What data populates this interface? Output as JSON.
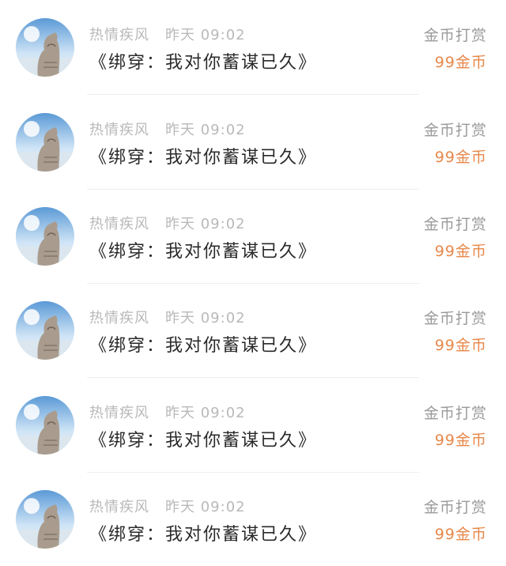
{
  "colors": {
    "meta_text": "#b9b9b9",
    "title_text": "#2a2a2a",
    "action_text": "#9a9a9a",
    "amount_text": "#e7884a"
  },
  "entries": [
    {
      "user": "热情疾风",
      "time": "昨天 09:02",
      "title": "《绑穿：我对你蓄谋已久》",
      "action": "金币打赏",
      "amount": "99金币",
      "avatar": "kitten-avatar"
    },
    {
      "user": "热情疾风",
      "time": "昨天 09:02",
      "title": "《绑穿：我对你蓄谋已久》",
      "action": "金币打赏",
      "amount": "99金币",
      "avatar": "kitten-avatar"
    },
    {
      "user": "热情疾风",
      "time": "昨天 09:02",
      "title": "《绑穿：我对你蓄谋已久》",
      "action": "金币打赏",
      "amount": "99金币",
      "avatar": "kitten-avatar"
    },
    {
      "user": "热情疾风",
      "time": "昨天 09:02",
      "title": "《绑穿：我对你蓄谋已久》",
      "action": "金币打赏",
      "amount": "99金币",
      "avatar": "kitten-avatar"
    },
    {
      "user": "热情疾风",
      "time": "昨天 09:02",
      "title": "《绑穿：我对你蓄谋已久》",
      "action": "金币打赏",
      "amount": "99金币",
      "avatar": "kitten-avatar"
    },
    {
      "user": "热情疾风",
      "time": "昨天 09:02",
      "title": "《绑穿：我对你蓄谋已久》",
      "action": "金币打赏",
      "amount": "99金币",
      "avatar": "kitten-avatar"
    }
  ]
}
